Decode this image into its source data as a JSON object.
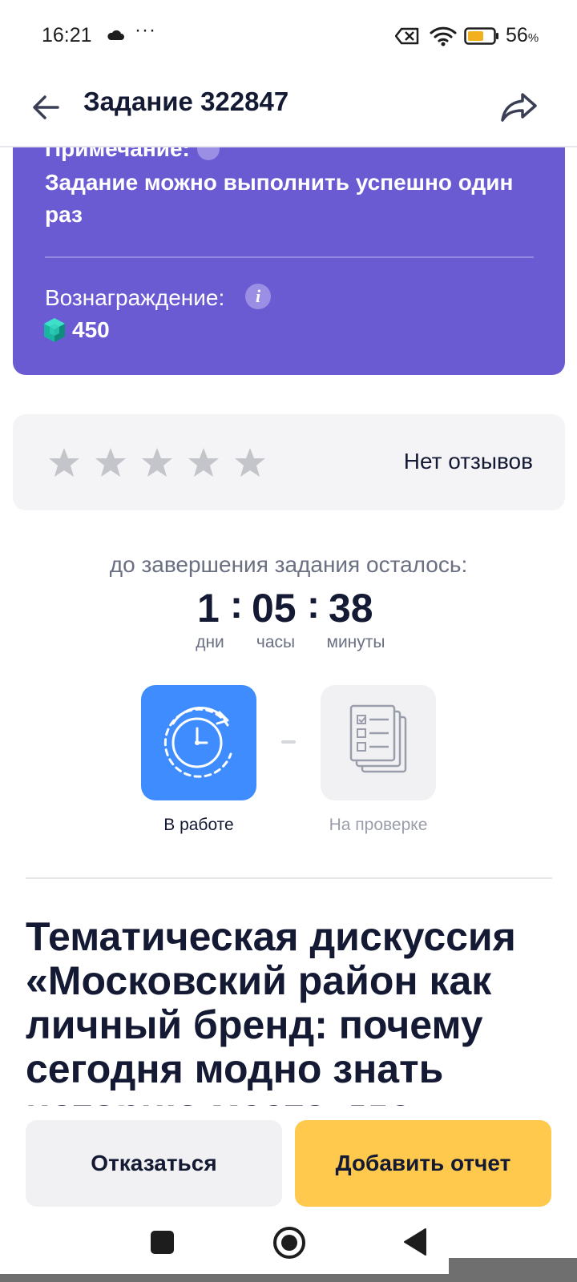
{
  "status_bar": {
    "time": "16:21",
    "more": "···",
    "battery_value": "56",
    "battery_unit": "%"
  },
  "app_bar": {
    "title": "Задание 322847"
  },
  "task_card": {
    "note_label": "Примечание:",
    "note_text": "Задание можно выполнить успешно один раз",
    "reward_label": "Вознаграждение:",
    "reward_info": "i",
    "reward_value": "450",
    "background_color": "#6b5bd3"
  },
  "reviews": {
    "rating_stars_filled": 0,
    "rating_stars_total": 5,
    "no_reviews_text": "Нет отзывов"
  },
  "countdown": {
    "caption": "до завершения задания осталось:",
    "days": "1",
    "hours": "05",
    "minutes": "38",
    "separator": ":",
    "days_label": "дни",
    "hours_label": "часы",
    "minutes_label": "минуты"
  },
  "steps": [
    {
      "label": "В работе",
      "icon": "clock-refresh-icon",
      "state": "active"
    },
    {
      "label": "На проверке",
      "icon": "checklist-docs-icon",
      "state": "inactive"
    }
  ],
  "task_title": "Тематическая дискуссия «Московский район как личный бренд: почему сегодня модно знать историю места, где",
  "buttons": {
    "decline": "Отказаться",
    "add_report": "Добавить отчет"
  },
  "colors": {
    "accent_blue": "#3f8cff",
    "accent_yellow": "#ffc94d",
    "purple": "#6b5bd3"
  }
}
